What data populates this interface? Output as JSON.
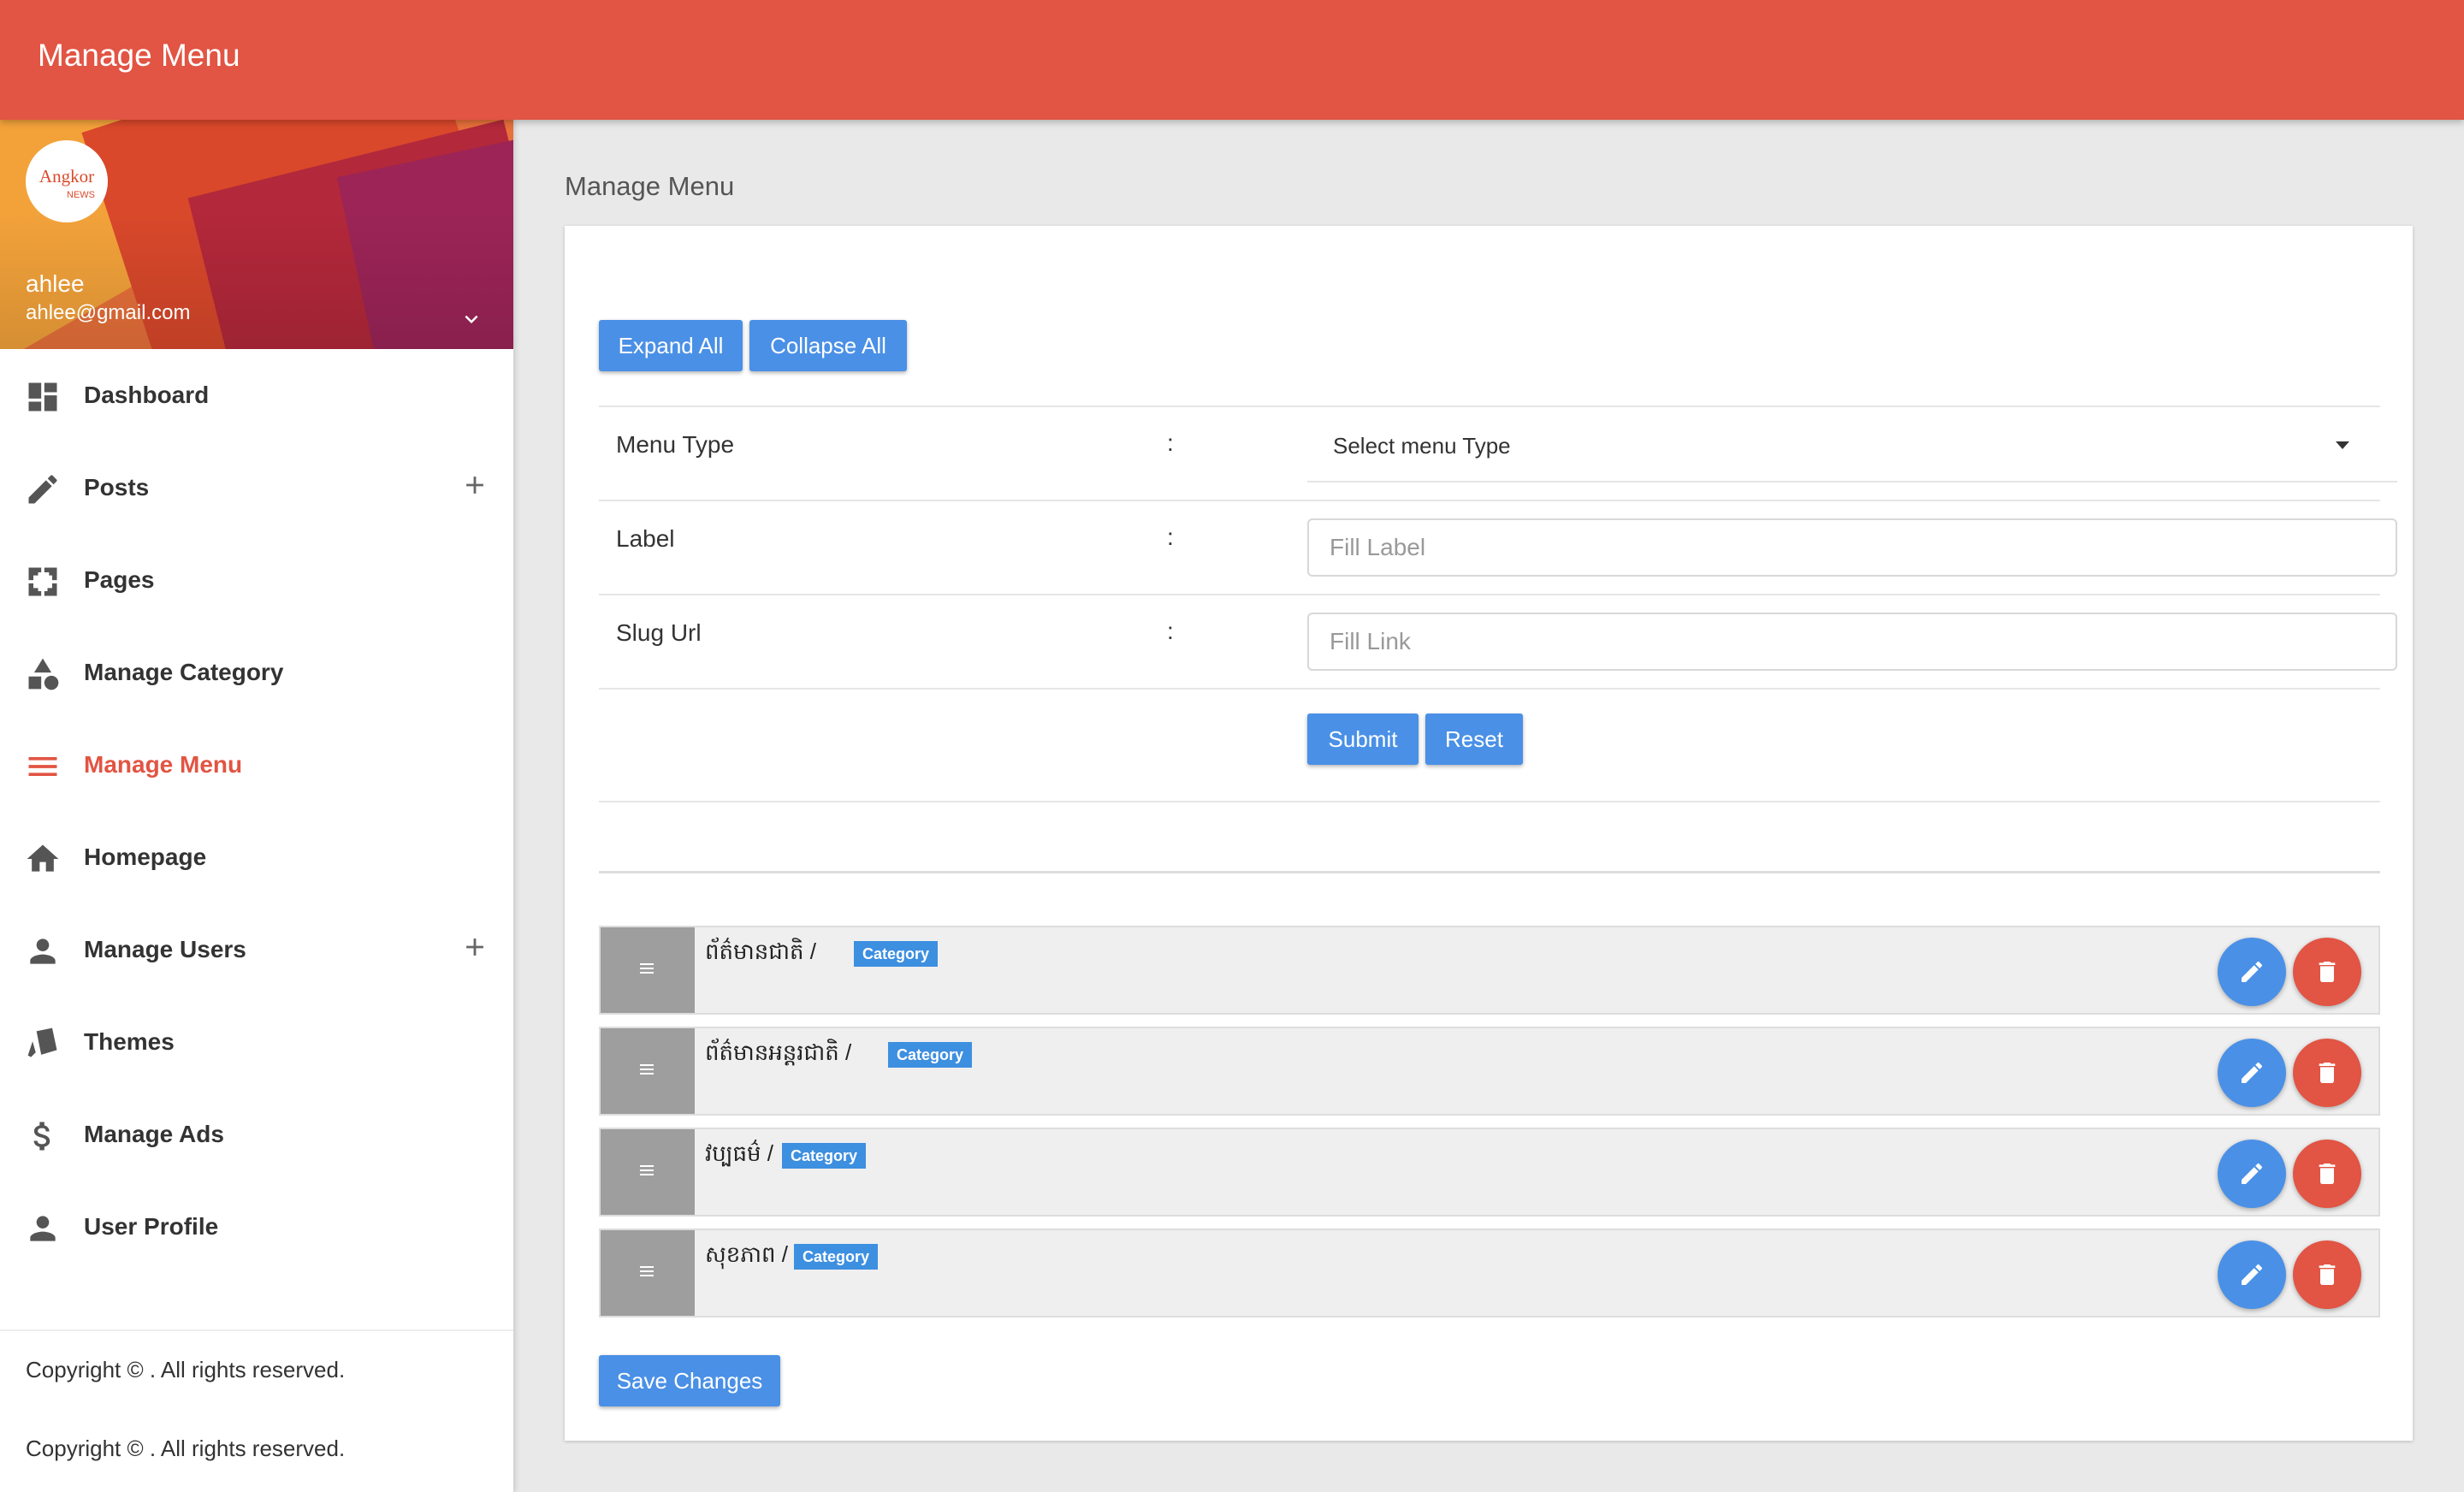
{
  "header": {
    "title": "Manage Menu"
  },
  "user": {
    "name": "ahlee",
    "email": "ahlee@gmail.com",
    "logo_text": "Angkor",
    "logo_sub": "NEWS"
  },
  "sidebar": {
    "items": [
      {
        "label": "Dashboard",
        "icon": "dashboard-icon"
      },
      {
        "label": "Posts",
        "icon": "pencil-icon",
        "expandable": true
      },
      {
        "label": "Pages",
        "icon": "pages-icon"
      },
      {
        "label": "Manage Category",
        "icon": "category-icon"
      },
      {
        "label": "Manage Menu",
        "icon": "menu-icon",
        "active": true
      },
      {
        "label": "Homepage",
        "icon": "home-icon"
      },
      {
        "label": "Manage Users",
        "icon": "person-icon",
        "expandable": true
      },
      {
        "label": "Themes",
        "icon": "themes-icon"
      },
      {
        "label": "Manage Ads",
        "icon": "dollar-icon"
      },
      {
        "label": "User Profile",
        "icon": "person-icon"
      }
    ],
    "copyright": [
      "Copyright © . All rights reserved.",
      "Copyright © . All rights reserved."
    ]
  },
  "main": {
    "page_title": "Manage Menu",
    "expand_all": "Expand All",
    "collapse_all": "Collapse All",
    "form": {
      "menu_type_label": "Menu Type",
      "menu_type_value": "Select menu Type",
      "label_label": "Label",
      "label_placeholder": "Fill Label",
      "slug_label": "Slug Url",
      "slug_placeholder": "Fill Link",
      "colon": ":",
      "submit": "Submit",
      "reset": "Reset"
    },
    "menu_items": [
      {
        "title": "ព័ត៌មានជាតិ /",
        "type": "Category"
      },
      {
        "title": "ព័ត៌មានអន្តរជាតិ /",
        "type": "Category"
      },
      {
        "title": "វប្បធម៌ /",
        "type": "Category"
      },
      {
        "title": "សុខភាព /",
        "type": "Category"
      }
    ],
    "save_changes": "Save Changes"
  },
  "colors": {
    "primary": "#e25443",
    "accent": "#4a90e6",
    "badge": "#3d8fe0"
  }
}
